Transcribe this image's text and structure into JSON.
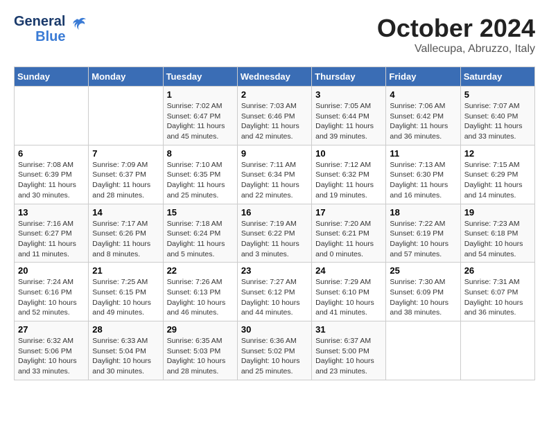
{
  "header": {
    "logo_general": "General",
    "logo_blue": "Blue",
    "month_title": "October 2024",
    "subtitle": "Vallecupa, Abruzzo, Italy"
  },
  "days_of_week": [
    "Sunday",
    "Monday",
    "Tuesday",
    "Wednesday",
    "Thursday",
    "Friday",
    "Saturday"
  ],
  "weeks": [
    [
      {
        "day": "",
        "sunrise": "",
        "sunset": "",
        "daylight": ""
      },
      {
        "day": "",
        "sunrise": "",
        "sunset": "",
        "daylight": ""
      },
      {
        "day": "1",
        "sunrise": "Sunrise: 7:02 AM",
        "sunset": "Sunset: 6:47 PM",
        "daylight": "Daylight: 11 hours and 45 minutes."
      },
      {
        "day": "2",
        "sunrise": "Sunrise: 7:03 AM",
        "sunset": "Sunset: 6:46 PM",
        "daylight": "Daylight: 11 hours and 42 minutes."
      },
      {
        "day": "3",
        "sunrise": "Sunrise: 7:05 AM",
        "sunset": "Sunset: 6:44 PM",
        "daylight": "Daylight: 11 hours and 39 minutes."
      },
      {
        "day": "4",
        "sunrise": "Sunrise: 7:06 AM",
        "sunset": "Sunset: 6:42 PM",
        "daylight": "Daylight: 11 hours and 36 minutes."
      },
      {
        "day": "5",
        "sunrise": "Sunrise: 7:07 AM",
        "sunset": "Sunset: 6:40 PM",
        "daylight": "Daylight: 11 hours and 33 minutes."
      }
    ],
    [
      {
        "day": "6",
        "sunrise": "Sunrise: 7:08 AM",
        "sunset": "Sunset: 6:39 PM",
        "daylight": "Daylight: 11 hours and 30 minutes."
      },
      {
        "day": "7",
        "sunrise": "Sunrise: 7:09 AM",
        "sunset": "Sunset: 6:37 PM",
        "daylight": "Daylight: 11 hours and 28 minutes."
      },
      {
        "day": "8",
        "sunrise": "Sunrise: 7:10 AM",
        "sunset": "Sunset: 6:35 PM",
        "daylight": "Daylight: 11 hours and 25 minutes."
      },
      {
        "day": "9",
        "sunrise": "Sunrise: 7:11 AM",
        "sunset": "Sunset: 6:34 PM",
        "daylight": "Daylight: 11 hours and 22 minutes."
      },
      {
        "day": "10",
        "sunrise": "Sunrise: 7:12 AM",
        "sunset": "Sunset: 6:32 PM",
        "daylight": "Daylight: 11 hours and 19 minutes."
      },
      {
        "day": "11",
        "sunrise": "Sunrise: 7:13 AM",
        "sunset": "Sunset: 6:30 PM",
        "daylight": "Daylight: 11 hours and 16 minutes."
      },
      {
        "day": "12",
        "sunrise": "Sunrise: 7:15 AM",
        "sunset": "Sunset: 6:29 PM",
        "daylight": "Daylight: 11 hours and 14 minutes."
      }
    ],
    [
      {
        "day": "13",
        "sunrise": "Sunrise: 7:16 AM",
        "sunset": "Sunset: 6:27 PM",
        "daylight": "Daylight: 11 hours and 11 minutes."
      },
      {
        "day": "14",
        "sunrise": "Sunrise: 7:17 AM",
        "sunset": "Sunset: 6:26 PM",
        "daylight": "Daylight: 11 hours and 8 minutes."
      },
      {
        "day": "15",
        "sunrise": "Sunrise: 7:18 AM",
        "sunset": "Sunset: 6:24 PM",
        "daylight": "Daylight: 11 hours and 5 minutes."
      },
      {
        "day": "16",
        "sunrise": "Sunrise: 7:19 AM",
        "sunset": "Sunset: 6:22 PM",
        "daylight": "Daylight: 11 hours and 3 minutes."
      },
      {
        "day": "17",
        "sunrise": "Sunrise: 7:20 AM",
        "sunset": "Sunset: 6:21 PM",
        "daylight": "Daylight: 11 hours and 0 minutes."
      },
      {
        "day": "18",
        "sunrise": "Sunrise: 7:22 AM",
        "sunset": "Sunset: 6:19 PM",
        "daylight": "Daylight: 10 hours and 57 minutes."
      },
      {
        "day": "19",
        "sunrise": "Sunrise: 7:23 AM",
        "sunset": "Sunset: 6:18 PM",
        "daylight": "Daylight: 10 hours and 54 minutes."
      }
    ],
    [
      {
        "day": "20",
        "sunrise": "Sunrise: 7:24 AM",
        "sunset": "Sunset: 6:16 PM",
        "daylight": "Daylight: 10 hours and 52 minutes."
      },
      {
        "day": "21",
        "sunrise": "Sunrise: 7:25 AM",
        "sunset": "Sunset: 6:15 PM",
        "daylight": "Daylight: 10 hours and 49 minutes."
      },
      {
        "day": "22",
        "sunrise": "Sunrise: 7:26 AM",
        "sunset": "Sunset: 6:13 PM",
        "daylight": "Daylight: 10 hours and 46 minutes."
      },
      {
        "day": "23",
        "sunrise": "Sunrise: 7:27 AM",
        "sunset": "Sunset: 6:12 PM",
        "daylight": "Daylight: 10 hours and 44 minutes."
      },
      {
        "day": "24",
        "sunrise": "Sunrise: 7:29 AM",
        "sunset": "Sunset: 6:10 PM",
        "daylight": "Daylight: 10 hours and 41 minutes."
      },
      {
        "day": "25",
        "sunrise": "Sunrise: 7:30 AM",
        "sunset": "Sunset: 6:09 PM",
        "daylight": "Daylight: 10 hours and 38 minutes."
      },
      {
        "day": "26",
        "sunrise": "Sunrise: 7:31 AM",
        "sunset": "Sunset: 6:07 PM",
        "daylight": "Daylight: 10 hours and 36 minutes."
      }
    ],
    [
      {
        "day": "27",
        "sunrise": "Sunrise: 6:32 AM",
        "sunset": "Sunset: 5:06 PM",
        "daylight": "Daylight: 10 hours and 33 minutes."
      },
      {
        "day": "28",
        "sunrise": "Sunrise: 6:33 AM",
        "sunset": "Sunset: 5:04 PM",
        "daylight": "Daylight: 10 hours and 30 minutes."
      },
      {
        "day": "29",
        "sunrise": "Sunrise: 6:35 AM",
        "sunset": "Sunset: 5:03 PM",
        "daylight": "Daylight: 10 hours and 28 minutes."
      },
      {
        "day": "30",
        "sunrise": "Sunrise: 6:36 AM",
        "sunset": "Sunset: 5:02 PM",
        "daylight": "Daylight: 10 hours and 25 minutes."
      },
      {
        "day": "31",
        "sunrise": "Sunrise: 6:37 AM",
        "sunset": "Sunset: 5:00 PM",
        "daylight": "Daylight: 10 hours and 23 minutes."
      },
      {
        "day": "",
        "sunrise": "",
        "sunset": "",
        "daylight": ""
      },
      {
        "day": "",
        "sunrise": "",
        "sunset": "",
        "daylight": ""
      }
    ]
  ]
}
